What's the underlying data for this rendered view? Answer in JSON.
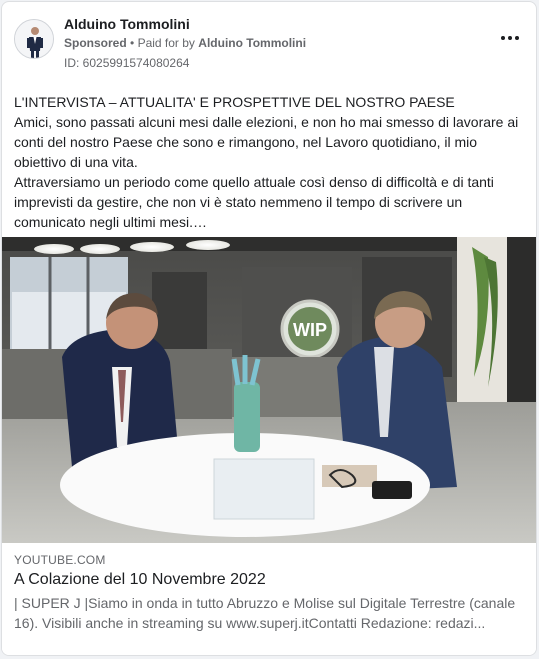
{
  "post": {
    "page_name": "Alduino Tommolini",
    "sponsored_label": "Sponsored",
    "separator": "•",
    "paid_for_prefix": "Paid for by",
    "paid_for_name": "Alduino Tommolini",
    "ad_id": "ID: 6025991574080264",
    "more_icon": "more-dots-icon",
    "body_text": "L'INTERVISTA – ATTUALITA' E PROSPETTIVE DEL NOSTRO PAESE\nAmici, sono passati alcuni mesi dalle elezioni, e non ho mai smesso di lavorare ai conti del nostro Paese che sono e rimangono, nel Lavoro quotidiano, il mio obiettivo di una vita.\nAttraversiamo un periodo come quello attuale così denso di difficoltà e di tanti imprevisti da gestire, che non vi è stato nemmeno il tempo di scrivere un comunicato negli ultimi mesi.…"
  },
  "media": {
    "logo_text": "WIP"
  },
  "link_preview": {
    "domain": "YOUTUBE.COM",
    "title": "A Colazione del 10 Novembre 2022",
    "description": "| SUPER J |Siamo in onda in tutto Abruzzo e Molise sul Digitale Terrestre (canale 16). Visibili anche in streaming su www.superj.itContatti Redazione: redazi..."
  },
  "colors": {
    "text_primary": "#1c1e21",
    "text_secondary": "#65676b",
    "card_background": "#ffffff"
  }
}
